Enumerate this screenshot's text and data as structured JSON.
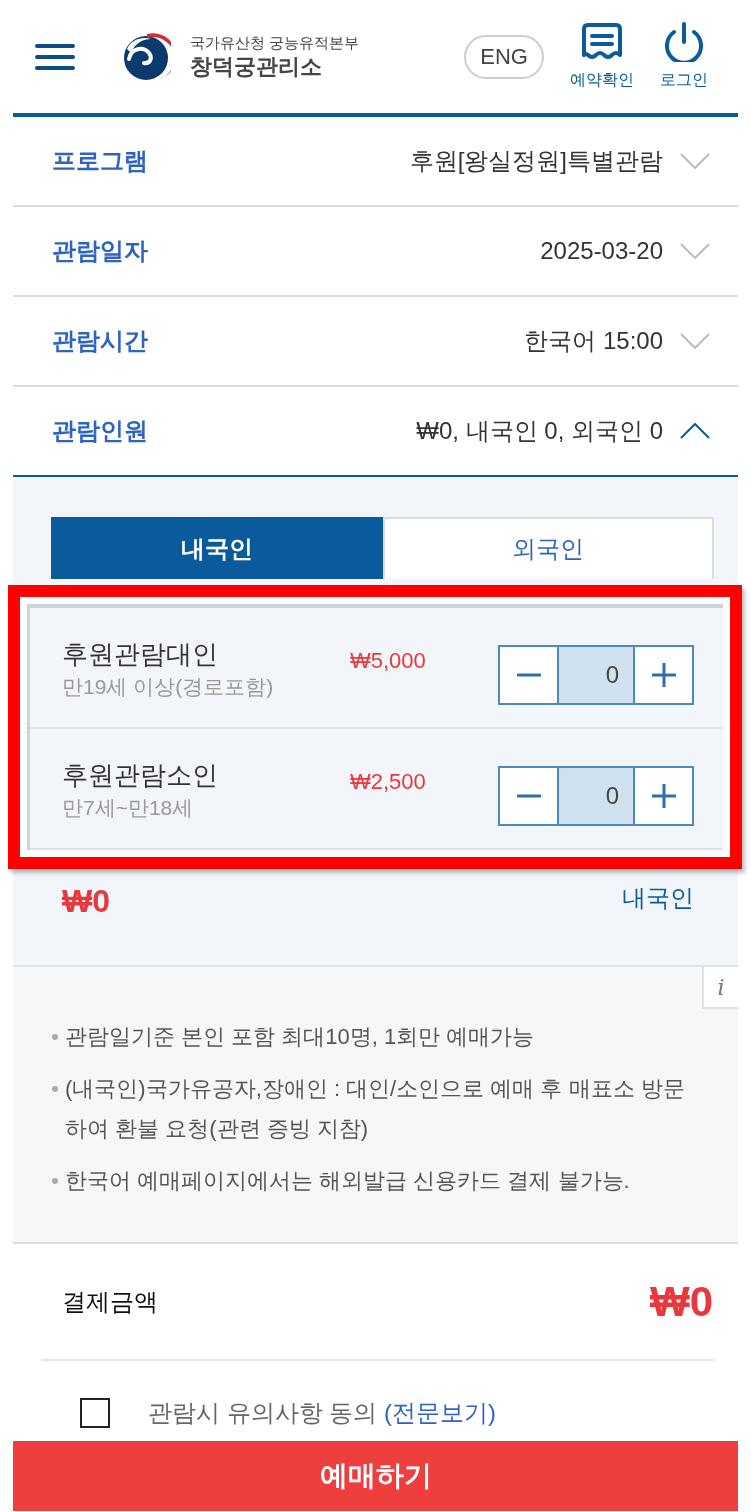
{
  "header": {
    "org_line": "국가유산청 궁능유적본부",
    "org_name": "창덕궁관리소",
    "language_button": "ENG",
    "actions": [
      {
        "kind": "reservation",
        "label": "예약확인"
      },
      {
        "kind": "power",
        "label": "로그인"
      }
    ]
  },
  "fields": [
    {
      "label": "프로그램",
      "value": "후원[왕실정원]특별관람",
      "expanded": false
    },
    {
      "label": "관람일자",
      "value": "2025-03-20",
      "expanded": false
    },
    {
      "label": "관람시간",
      "value": "한국어 15:00",
      "expanded": false
    },
    {
      "label": "관람인원",
      "value": "₩0, 내국인 0, 외국인 0",
      "expanded": true
    }
  ],
  "visitor_tabs": [
    {
      "label": "내국인",
      "selected": true
    },
    {
      "label": "외국인",
      "selected": false
    }
  ],
  "ticket_panel": {
    "highlighted": true,
    "items": [
      {
        "name": "후원관람대인",
        "condition": "만19세 이상(경로포함)",
        "price": "₩5,000",
        "quantity": "0"
      },
      {
        "name": "후원관람소인",
        "condition": "만7세~만18세",
        "price": "₩2,500",
        "quantity": "0"
      }
    ]
  },
  "subtotal": {
    "amount": "₩0",
    "category": "내국인"
  },
  "notices": {
    "info_button": "i",
    "items": [
      "관람일기준 본인 포함 최대10명, 1회만 예매가능",
      "(내국인)국가유공자,장애인 : 대인/소인으로 예매 후 매표소 방문하여 환불 요청(관련 증빙 지참)",
      "한국어 예매페이지에서는 해외발급 신용카드 결제 불가능."
    ]
  },
  "payment": {
    "label": "결제금액",
    "amount": "₩0"
  },
  "agreement": {
    "checked": false,
    "text": "관람시 유의사항 동의",
    "link": "(전문보기)"
  },
  "submit_button": "예매하기"
}
